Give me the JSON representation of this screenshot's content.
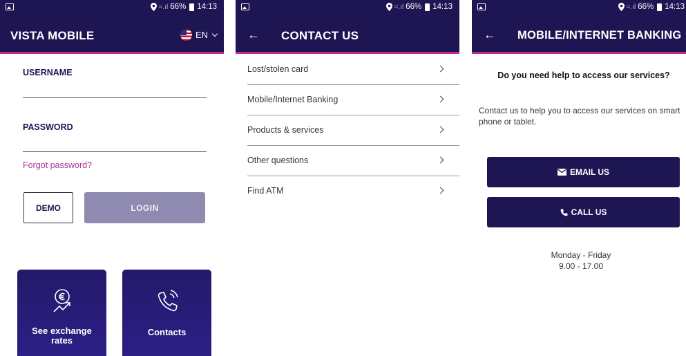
{
  "status_bar": {
    "battery": "66%",
    "time": "14:13"
  },
  "login_screen": {
    "title": "VISTA MOBILE",
    "language": "EN",
    "username_label": "USERNAME",
    "password_label": "PASSWORD",
    "forgot_password": "Forgot password?",
    "demo_label": "DEMO",
    "login_label": "LOGIN",
    "tiles": [
      {
        "label_line1": "See exchange",
        "label_line2": "rates",
        "icon": "euro-trend-icon"
      },
      {
        "label": "Contacts",
        "icon": "phone-icon"
      }
    ]
  },
  "contact_screen": {
    "title": "CONTACT US",
    "items": [
      {
        "label": "Lost/stolen card"
      },
      {
        "label": "Mobile/Internet Banking"
      },
      {
        "label": "Products & services"
      },
      {
        "label": "Other questions"
      },
      {
        "label": "Find ATM"
      }
    ]
  },
  "banking_screen": {
    "title": "MOBILE/INTERNET BANKING",
    "heading": "Do you need help to access our services?",
    "text": "Contact us to help you to access our services on smart phone or tablet.",
    "email_label": "EMAIL US",
    "call_label": "CALL US",
    "hours_days": "Monday - Friday",
    "hours_time": "9.00 - 17.00"
  },
  "colors": {
    "brand_navy": "#1e1553",
    "accent_magenta": "#c02b8d",
    "link_pink": "#b0339b",
    "disabled_button": "#8f8ab0"
  }
}
